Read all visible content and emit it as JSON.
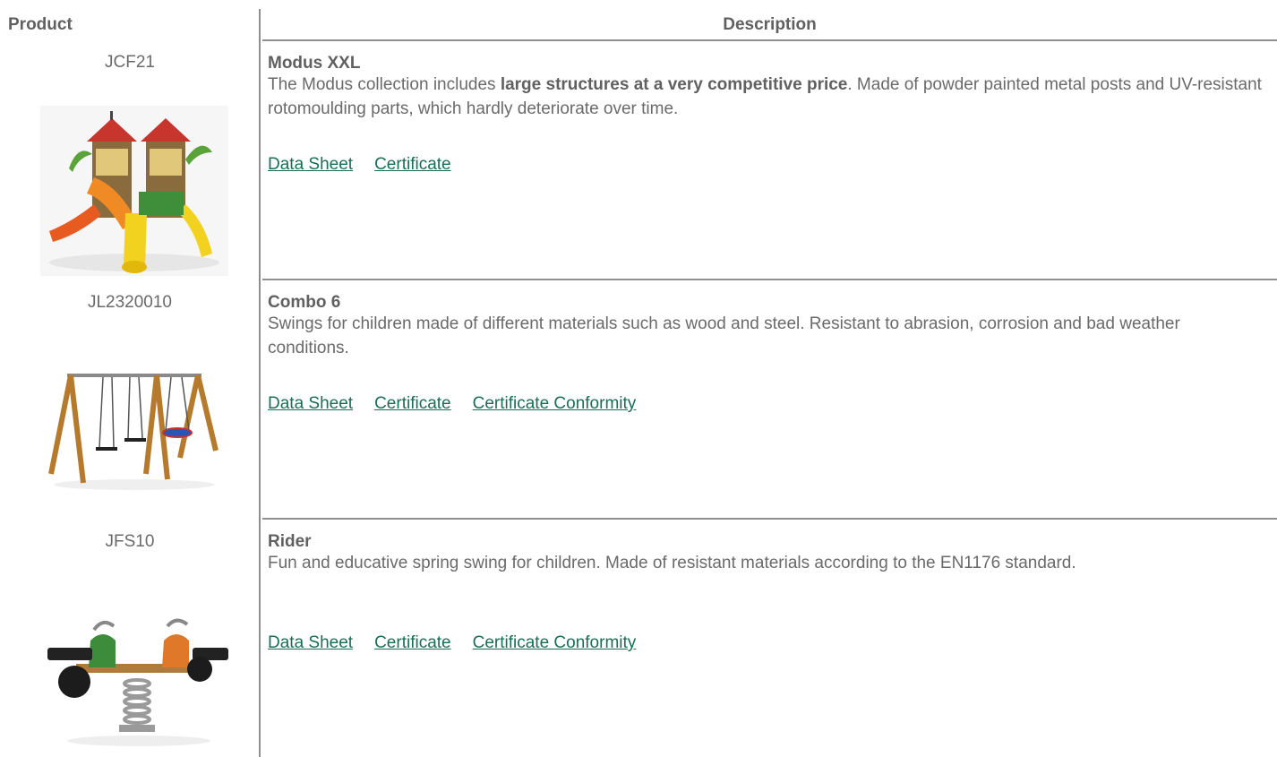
{
  "table": {
    "headers": {
      "product": "Product",
      "description": "Description"
    }
  },
  "rows": [
    {
      "code": "JCF21",
      "title": "Modus XXL",
      "desc_before": "The Modus collection includes ",
      "desc_bold": "large structures at a very competitive price",
      "desc_after": ". Made of powder painted metal posts and UV-resistant rotomoulding parts, which hardly deteriorate over time.",
      "links": [
        "Data Sheet",
        "Certificate"
      ]
    },
    {
      "code": "JL2320010",
      "title": "Combo 6",
      "desc": "Swings for children made of different materials such as wood and steel. Resistant to abrasion, corrosion and bad weather conditions.",
      "links": [
        "Data Sheet",
        "Certificate",
        "Certificate Conformity"
      ]
    },
    {
      "code": "JFS10",
      "title": "Rider",
      "desc": "Fun and educative spring swing for children. Made of resistant materials according to the EN1176 standard.",
      "links": [
        "Data Sheet",
        "Certificate",
        "Certificate Conformity"
      ]
    }
  ],
  "colors": {
    "link": "#1a6e55",
    "text": "#6a6a6a",
    "rule": "#8f8f8f"
  }
}
